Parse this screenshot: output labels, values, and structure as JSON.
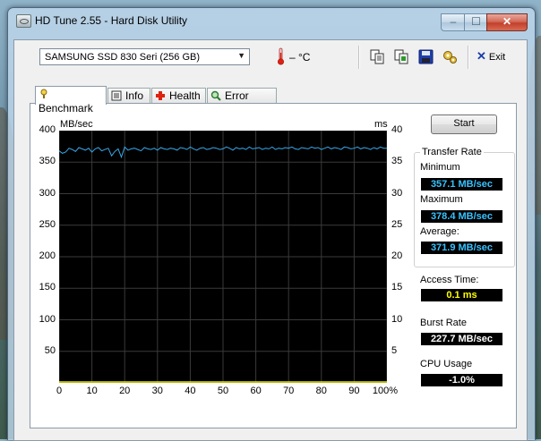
{
  "window": {
    "title": "HD Tune 2.55 - Hard Disk Utility",
    "minimize_glyph": "–",
    "maximize_glyph": "☐",
    "close_glyph": "✕"
  },
  "toolbar": {
    "drive": "SAMSUNG SSD 830 Seri (256 GB)",
    "drive_arrow": "▼",
    "temperature": "– °C",
    "exit_label": "Exit",
    "icons": [
      "copy-text-icon",
      "copy-screenshot-icon",
      "save-icon",
      "options-icon"
    ]
  },
  "tabs": [
    {
      "label": "Benchmark",
      "icon": "benchmark-icon",
      "active": true
    },
    {
      "label": "Info",
      "icon": "info-icon",
      "active": false
    },
    {
      "label": "Health",
      "icon": "health-icon",
      "active": false
    },
    {
      "label": "Error Scan",
      "icon": "error-scan-icon",
      "active": false
    }
  ],
  "chart_data": {
    "type": "line",
    "left_axis_label": "MB/sec",
    "right_axis_label": "ms",
    "y_left_ticks": [
      400,
      350,
      300,
      250,
      200,
      150,
      100,
      50
    ],
    "y_right_ticks": [
      40,
      35,
      30,
      25,
      20,
      15,
      10,
      5
    ],
    "x_ticks": [
      "0",
      "10",
      "20",
      "30",
      "40",
      "50",
      "60",
      "70",
      "80",
      "90",
      "100%"
    ],
    "ylim": [
      0,
      400
    ],
    "y2lim": [
      0,
      40
    ],
    "xlim": [
      0,
      100
    ],
    "grid": true,
    "colors": {
      "background": "#000000",
      "grid": "#3a3a3a",
      "transfer": "#36a8e8",
      "access": "#e8e800"
    },
    "series": [
      {
        "values": [
          368,
          364,
          366,
          372,
          370,
          367,
          373,
          371,
          369,
          372,
          366,
          371,
          373,
          368,
          370,
          372,
          360,
          367,
          371,
          358,
          374,
          369,
          371,
          372,
          370,
          368,
          373,
          371,
          370,
          372,
          369,
          373,
          371,
          370,
          372,
          371,
          369,
          373,
          372,
          370,
          374,
          371,
          369,
          372,
          373,
          370,
          371,
          373,
          372,
          370,
          371,
          374,
          372,
          369,
          373,
          371,
          372,
          370,
          374,
          371,
          372,
          373,
          370,
          372,
          371,
          374,
          370,
          372,
          371,
          373,
          372,
          374,
          371,
          370,
          373,
          372,
          371,
          374,
          372,
          373,
          370,
          372,
          374,
          371,
          373,
          372,
          370,
          374,
          373,
          371,
          372,
          374,
          371,
          373,
          372,
          370,
          373,
          371,
          374,
          372,
          372
        ]
      }
    ],
    "access_series": [
      {
        "values": [
          0.12,
          0.1,
          0.11,
          0.1,
          0.12,
          0.1,
          0.11,
          0.1,
          0.12,
          0.11,
          0.1,
          0.12,
          0.1,
          0.11,
          0.12,
          0.1,
          0.11,
          0.1,
          0.12,
          0.11,
          0.1
        ]
      }
    ]
  },
  "side": {
    "start_label": "Start",
    "transfer_rate_title": "Transfer Rate",
    "minimum_label": "Minimum",
    "minimum_value": "357.1 MB/sec",
    "maximum_label": "Maximum",
    "maximum_value": "378.4 MB/sec",
    "average_label": "Average:",
    "average_value": "371.9 MB/sec",
    "access_time_label": "Access Time:",
    "access_time_value": "0.1 ms",
    "burst_rate_label": "Burst Rate",
    "burst_rate_value": "227.7 MB/sec",
    "cpu_usage_label": "CPU Usage",
    "cpu_usage_value": "-1.0%"
  }
}
